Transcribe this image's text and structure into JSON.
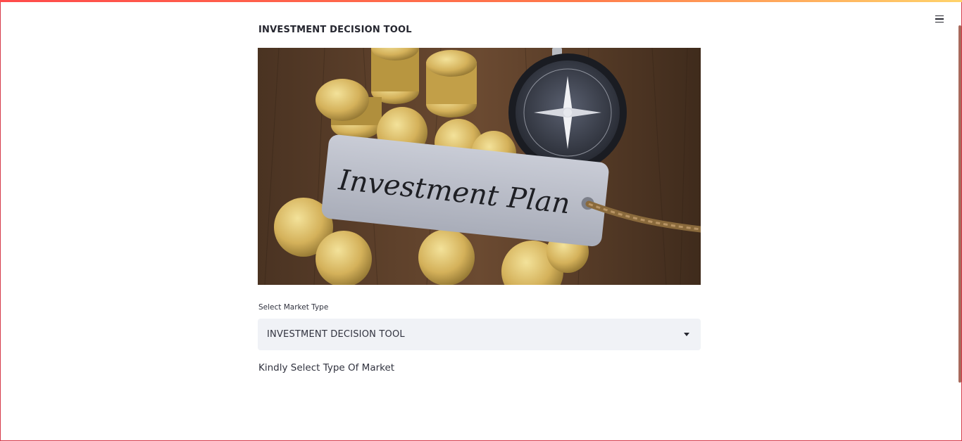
{
  "app": {
    "title": "INVESTMENT DECISION TOOL",
    "menu_icon": "hamburger-menu-icon"
  },
  "hero": {
    "image_subject": "coins, compass and tag",
    "tag_text": "Investment Plan"
  },
  "market_select": {
    "label": "Select Market Type",
    "selected_value": "INVESTMENT DECISION TOOL",
    "caret_icon": "chevron-down-icon"
  },
  "helper": {
    "text": "Kindly Select Type Of Market"
  },
  "colors": {
    "accent": "#ff4b4b",
    "text": "#31333f",
    "select_bg": "#f0f2f6"
  }
}
